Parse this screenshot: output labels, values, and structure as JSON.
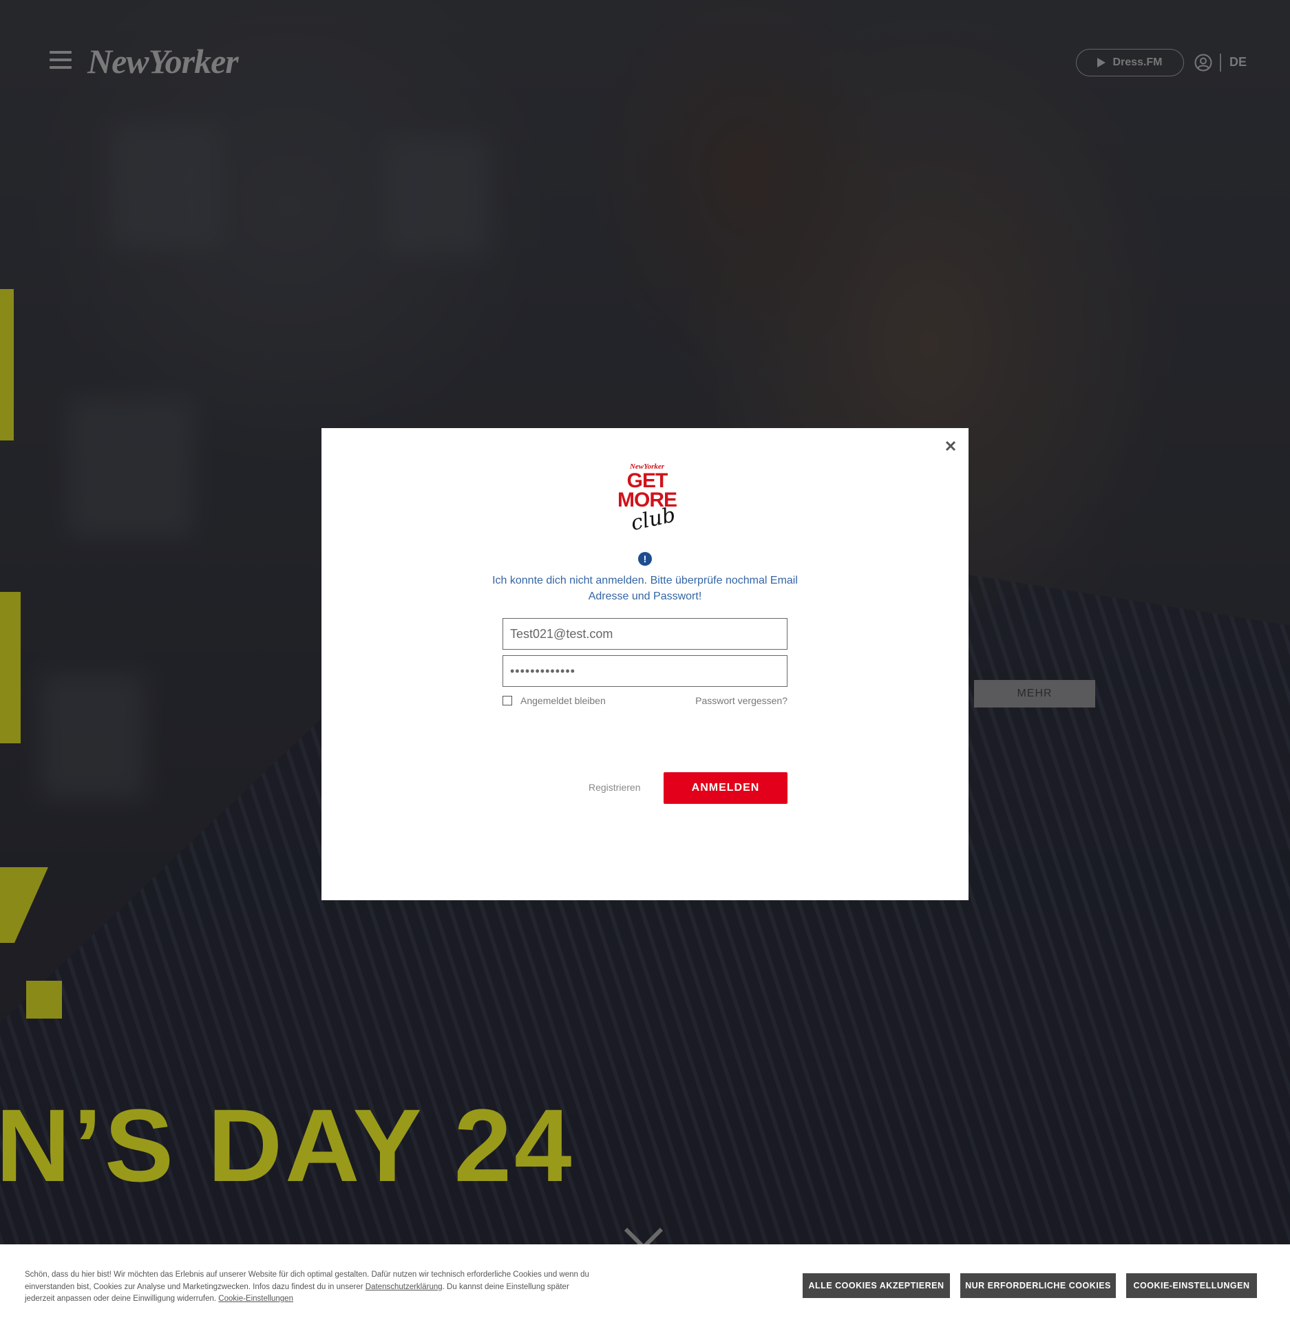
{
  "header": {
    "menu_icon": "hamburger-icon",
    "logo_text": "NewYorker",
    "dressfm_label": "Dress.FM",
    "play_icon": "play-icon",
    "account_icon": "user-circle-icon",
    "language": "DE"
  },
  "hero": {
    "headline": "N’S DAY 24",
    "more_label": "MEHR",
    "scroll_icon": "chevron-down-icon",
    "accent_color": "#9a9a1a"
  },
  "modal": {
    "logo": {
      "brand": "NewYorker",
      "line1": "GET",
      "line2": "MORE",
      "line3": "club"
    },
    "error_icon": "exclamation-circle-icon",
    "error_message": "Ich konnte dich nicht anmelden. Bitte überprüfe nochmal Email Adresse und Passwort!",
    "email_value": "Test021@test.com",
    "password_value": "•••••••••••••",
    "remember_label": "Angemeldet bleiben",
    "remember_checked": false,
    "forgot_label": "Passwort vergessen?",
    "register_label": "Registrieren",
    "login_label": "ANMELDEN",
    "close_icon": "close-icon",
    "brand_color": "#e2001a"
  },
  "cookie_bar": {
    "text_part1": "Schön, dass du hier bist! Wir möchten das Erlebnis auf unserer Website für dich optimal gestalten. Dafür nutzen wir technisch erforderliche Cookies und wenn du einverstanden bist, Cookies zur Analyse und Marketingzwecken. Infos dazu findest du in unserer ",
    "privacy_link": "Datenschutzerklärung",
    "text_part2": ". Du kannst deine Einstellung später jederzeit anpassen oder deine Einwilligung widerrufen. ",
    "settings_link": "Cookie-Einstellungen",
    "accept_all_label": "ALLE COOKIES AKZEPTIEREN",
    "required_only_label": "NUR ERFORDERLICHE COOKIES",
    "settings_label": "COOKIE-EINSTELLUNGEN"
  }
}
